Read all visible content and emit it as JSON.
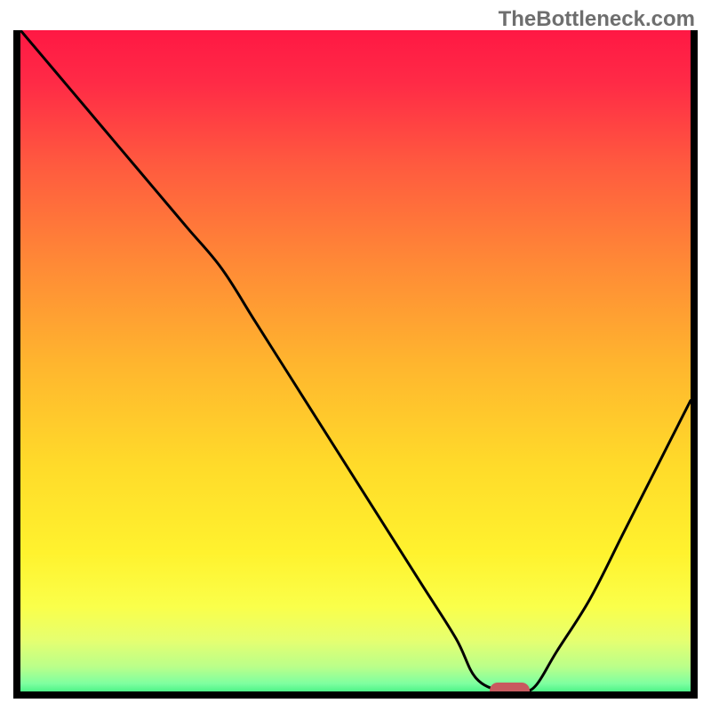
{
  "watermark": "TheBottleneck.com",
  "chart_data": {
    "type": "line",
    "title": "",
    "xlabel": "",
    "ylabel": "",
    "xlim": [
      0,
      100
    ],
    "ylim": [
      0,
      100
    ],
    "x": [
      0,
      5,
      10,
      15,
      20,
      25,
      30,
      35,
      40,
      45,
      50,
      55,
      60,
      65,
      68,
      72,
      75,
      77,
      80,
      85,
      90,
      95,
      100
    ],
    "y": [
      100,
      94,
      88,
      82,
      76,
      70,
      64,
      56,
      48,
      40,
      32,
      24,
      16,
      8,
      2,
      0,
      0,
      1,
      6,
      14,
      24,
      34,
      44
    ],
    "optimal_marker": {
      "x_start": 70,
      "x_end": 76,
      "y": 0.2
    },
    "gradient_stops": [
      {
        "pos": 0.0,
        "color": "#ff1844"
      },
      {
        "pos": 0.08,
        "color": "#ff2b46"
      },
      {
        "pos": 0.2,
        "color": "#ff5a3f"
      },
      {
        "pos": 0.35,
        "color": "#ff8a36"
      },
      {
        "pos": 0.5,
        "color": "#ffb62e"
      },
      {
        "pos": 0.65,
        "color": "#ffdb2a"
      },
      {
        "pos": 0.78,
        "color": "#fff22e"
      },
      {
        "pos": 0.86,
        "color": "#faff4a"
      },
      {
        "pos": 0.91,
        "color": "#e6ff70"
      },
      {
        "pos": 0.95,
        "color": "#baff8a"
      },
      {
        "pos": 0.975,
        "color": "#7effa0"
      },
      {
        "pos": 1.0,
        "color": "#18e76e"
      }
    ]
  },
  "plot": {
    "inner_width": 754,
    "inner_height": 744
  }
}
